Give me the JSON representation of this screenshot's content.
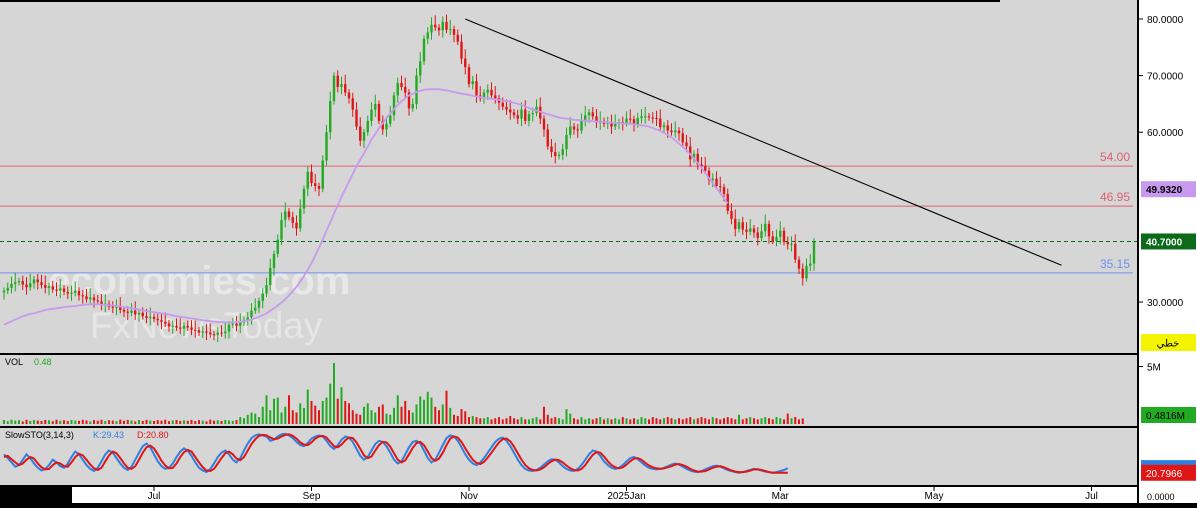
{
  "colors": {
    "pane_bg": "#d6d6d6",
    "axis_bg": "#ffffff",
    "up_candle": "#22aa22",
    "down_candle": "#e01515",
    "ma_line": "#c79af0",
    "trendline": "#000000",
    "resistance": "#e06070",
    "support": "#6f8ff0",
    "last_price": "#0c6b1a",
    "stoch_k": "#2f7fe0",
    "stoch_d": "#e01515",
    "badge_yellow": "#f4f400"
  },
  "watermark": {
    "line1": "economies.com",
    "line2": "FxNewsToday"
  },
  "badge": {
    "label": "خطي"
  },
  "chart_data": [
    {
      "type": "candlestick",
      "pane": "price",
      "ylim": [
        21,
        83
      ],
      "y_ticks": [
        "80.0000",
        "70.0000",
        "60.0000",
        "30.0000"
      ],
      "x_ticks": [
        "Jul",
        "Sep",
        "Nov",
        "2025Jan",
        "Mar",
        "May",
        "Jul"
      ],
      "x_anchors": [
        {
          "label": "Jul",
          "index": 40
        },
        {
          "label": "Sep",
          "index": 82
        },
        {
          "label": "Nov",
          "index": 124
        },
        {
          "label": "2025Jan",
          "index": 166
        },
        {
          "label": "Mar",
          "index": 207
        },
        {
          "label": "May",
          "index": 248
        },
        {
          "label": "Jul",
          "index": 290
        }
      ],
      "close": [
        32,
        32.5,
        33.2,
        33.5,
        33.7,
        33.1,
        32.6,
        33.3,
        34,
        33.5,
        33,
        32.5,
        32.8,
        32.2,
        32,
        32.4,
        31.8,
        31.5,
        31.6,
        32,
        31.2,
        31,
        30.5,
        30.8,
        30.3,
        30.1,
        29.5,
        29.7,
        29.2,
        29,
        29.2,
        28.6,
        28.3,
        28.1,
        28.5,
        27.8,
        28.1,
        27.5,
        27.2,
        27.4,
        27,
        26.8,
        26.5,
        26.2,
        25.7,
        25.8,
        25.5,
        25.3,
        25.8,
        25.5,
        25.1,
        25,
        24.6,
        24.8,
        24.6,
        24.3,
        24.2,
        24.6,
        24.5,
        24.8,
        26,
        26.2,
        25.8,
        26.4,
        26.8,
        27.3,
        28.5,
        29,
        30.2,
        31.5,
        33,
        36,
        38.5,
        41,
        44.5,
        46,
        45,
        44,
        43,
        46.5,
        50,
        53,
        51,
        50.5,
        50,
        55,
        60,
        65.5,
        70,
        68,
        68.5,
        67,
        66,
        64,
        61,
        58.5,
        60,
        62,
        64,
        65,
        62,
        60.5,
        61.5,
        63,
        66.5,
        68.7,
        68,
        67,
        64.2,
        65,
        70,
        72.5,
        76.5,
        77.6,
        79,
        78.5,
        78,
        79.5,
        78.1,
        78.2,
        77.2,
        76,
        73,
        71.5,
        68.5,
        69,
        66.5,
        66,
        67,
        67.5,
        66.5,
        66,
        65.2,
        64.5,
        64,
        63.5,
        63,
        62.4,
        64,
        62,
        63.2,
        63.4,
        64.5,
        62.4,
        60.5,
        57.5,
        56.5,
        55.8,
        56,
        57,
        59.5,
        61,
        60.5,
        60.3,
        62,
        63,
        63.5,
        62.8,
        61.7,
        62,
        61.5,
        61.8,
        61,
        61.5,
        61.8,
        61.6,
        62.4,
        62.3,
        61.4,
        62.5,
        62.8,
        62.8,
        62.6,
        62.5,
        62.4,
        60.9,
        61.2,
        60.3,
        60,
        60.3,
        59.8,
        58.2,
        57.5,
        55.2,
        56.2,
        54.3,
        54,
        53.2,
        51.6,
        51.8,
        50.5,
        50.3,
        49.1,
        46.1,
        44.7,
        42.9,
        44.1,
        42.8,
        42.4,
        43,
        42.3,
        41.3,
        42.5,
        43.8,
        41.6,
        40.8,
        41.5,
        42.6,
        40.6,
        40.2,
        40.3,
        37.5,
        35.9,
        34.2,
        36.4,
        36.8,
        40.7
      ],
      "ma_line": {
        "values": [
          26,
          26.3,
          26.6,
          26.9,
          27.2,
          27.5,
          27.7,
          27.9,
          28,
          28.2,
          28.4,
          28.6,
          28.7,
          28.8,
          28.9,
          29,
          29.1,
          29.2,
          29.25,
          29.3,
          29.4,
          29.5,
          29.55,
          29.6,
          29.6,
          29.6,
          29.55,
          29.5,
          29.45,
          29.4,
          29.3,
          29.2,
          29.1,
          29,
          28.9,
          28.8,
          28.7,
          28.5,
          28.4,
          28.3,
          28.2,
          28.1,
          28,
          27.9,
          27.8,
          27.65,
          27.5,
          27.4,
          27.3,
          27.2,
          27.1,
          27,
          26.9,
          26.8,
          26.7,
          26.6,
          26.55,
          26.5,
          26.45,
          26.4,
          26.4,
          26.4,
          26.45,
          26.5,
          26.6,
          26.75,
          26.9,
          27.15,
          27.4,
          27.7,
          28,
          28.45,
          28.9,
          29.4,
          29.9,
          30.5,
          31.2,
          31.9,
          32.7,
          33.6,
          34.6,
          35.7,
          36.9,
          38.2,
          39.6,
          41.1,
          42.6,
          44.1,
          45.6,
          47.1,
          48.6,
          49.95,
          51.3,
          52.65,
          54,
          55.15,
          56.3,
          57.5,
          58.7,
          59.7,
          60.7,
          61.6,
          62.5,
          63.3,
          64.1,
          64.8,
          65.5,
          66,
          66.5,
          66.8,
          67.1,
          67.3,
          67.5,
          67.55,
          67.6,
          67.6,
          67.6,
          67.5,
          67.4,
          67.25,
          67.1,
          66.95,
          66.8,
          66.7,
          66.6,
          66.45,
          66.3,
          66.2,
          66.1,
          66,
          65.9,
          65.8,
          65.7,
          65.6,
          65.5,
          65.35,
          65.2,
          65,
          64.8,
          64.55,
          64.3,
          64.05,
          63.8,
          63.6,
          63.4,
          63.2,
          63,
          62.8,
          62.6,
          62.5,
          62.4,
          62.3,
          62.2,
          62.15,
          62.1,
          62.05,
          62,
          61.95,
          61.9,
          61.85,
          61.8,
          61.75,
          61.7,
          61.65,
          61.6,
          61.55,
          61.5,
          61.45,
          61.4,
          61.3,
          61.2,
          61.1,
          61,
          60.75,
          60.5,
          60.2,
          59.9,
          59.5,
          59.1,
          58.55,
          58,
          57.4,
          56.8,
          56.1,
          55.4,
          54.55,
          53.7,
          52.8,
          51.9,
          51,
          50.1,
          49.2,
          48.3,
          47.4
        ]
      },
      "trendline": {
        "from": {
          "x_index": 123,
          "y": 80.0
        },
        "to": {
          "x_index": 282,
          "y": 36.5
        }
      },
      "horizontal_levels": [
        {
          "label": "54.00",
          "value": 54.0,
          "color": "#e06070"
        },
        {
          "label": "46.95",
          "value": 46.95,
          "color": "#e06070"
        },
        {
          "label": "35.15",
          "value": 35.15,
          "color": "#6f8ff0"
        }
      ],
      "last_price_line": {
        "value": 40.7,
        "style": "dashed"
      },
      "right_labels": [
        {
          "label": "49.9320",
          "value": 49.932,
          "kind": "ma"
        },
        {
          "label": "40.7000",
          "value": 40.7,
          "kind": "last"
        }
      ]
    },
    {
      "type": "bar",
      "pane": "volume",
      "title": "VOL",
      "current_label": "0.48",
      "ylim": [
        0,
        6
      ],
      "y_ticks": [
        "5M"
      ],
      "right_label": "0.4816M",
      "values": [
        0.35,
        0.25,
        0.38,
        0.3,
        0.33,
        0.22,
        0.37,
        0.27,
        0.34,
        0.3,
        0.26,
        0.36,
        0.32,
        0.24,
        0.38,
        0.28,
        0.33,
        0.25,
        0.35,
        0.3,
        0.27,
        0.37,
        0.31,
        0.23,
        0.34,
        0.29,
        0.36,
        0.26,
        0.33,
        0.3,
        0.25,
        0.38,
        0.28,
        0.35,
        0.31,
        0.22,
        0.34,
        0.27,
        0.36,
        0.3,
        0.26,
        0.33,
        0.29,
        0.37,
        0.24,
        0.31,
        0.35,
        0.27,
        0.32,
        0.28,
        0.36,
        0.25,
        0.34,
        0.3,
        0.23,
        0.38,
        0.29,
        0.32,
        0.26,
        0.35,
        0.31,
        0.28,
        0.34,
        0.6,
        0.5,
        0.8,
        1.0,
        0.9,
        0.6,
        1.5,
        2.5,
        1.2,
        2.2,
        2.3,
        1.0,
        1.5,
        2.5,
        1.2,
        1.0,
        1.8,
        1.4,
        3.0,
        2.0,
        1.6,
        1.2,
        2.0,
        2.3,
        3.5,
        5.3,
        2.2,
        3.2,
        2.0,
        1.8,
        1.2,
        0.9,
        0.8,
        1.5,
        1.8,
        1.2,
        1.0,
        1.5,
        1.7,
        0.9,
        0.8,
        1.4,
        2.5,
        1.5,
        2.0,
        1.2,
        1.0,
        1.7,
        2.4,
        2.1,
        2.8,
        2.3,
        1.5,
        1.2,
        1.7,
        2.9,
        1.4,
        0.8,
        0.7,
        1.3,
        1.1,
        0.6,
        0.7,
        0.6,
        0.5,
        0.5,
        0.6,
        0.4,
        0.5,
        0.6,
        0.4,
        0.5,
        0.7,
        0.5,
        0.4,
        0.6,
        0.4,
        0.4,
        0.5,
        0.6,
        0.4,
        1.5,
        0.8,
        0.5,
        0.6,
        0.5,
        0.4,
        1.3,
        0.9,
        0.5,
        0.4,
        0.6,
        0.4,
        0.5,
        0.4,
        0.5,
        0.6,
        0.4,
        0.5,
        0.4,
        0.5,
        0.4,
        0.6,
        0.5,
        0.4,
        0.5,
        0.4,
        0.6,
        0.5,
        0.4,
        0.6,
        0.5,
        0.4,
        0.5,
        0.6,
        0.5,
        0.4,
        0.5,
        0.4,
        0.5,
        0.6,
        0.4,
        0.5,
        0.6,
        0.5,
        0.4,
        0.6,
        0.5,
        0.4,
        0.5,
        0.6,
        0.5,
        0.4,
        0.8,
        0.4,
        0.5,
        0.6,
        0.5,
        0.4,
        0.5,
        0.6,
        0.5,
        0.4,
        0.6,
        0.5,
        0.4,
        0.9,
        0.5,
        0.6,
        0.4,
        0.48
      ],
      "up_flags": "derived from price close"
    },
    {
      "type": "line",
      "pane": "stochastic",
      "title": "SlowSTO(3,14,3)",
      "k_label": "K:29.43",
      "d_label": "D:20.80",
      "ylim": [
        0,
        100
      ],
      "y_ticks": [
        "0.0000"
      ],
      "right_labels": [
        {
          "label": "29.4340",
          "value": 29.434,
          "kind": "k"
        },
        {
          "label": "20.7966",
          "value": 20.7966,
          "kind": "d"
        }
      ],
      "series": [
        {
          "name": "K",
          "values": [
            55,
            48,
            40,
            32,
            35,
            45,
            55,
            48,
            38,
            30,
            25,
            28,
            35,
            45,
            40,
            33,
            30,
            38,
            50,
            60,
            55,
            45,
            35,
            28,
            24,
            30,
            42,
            55,
            62,
            58,
            48,
            38,
            30,
            26,
            32,
            45,
            58,
            70,
            75,
            68,
            55,
            42,
            33,
            28,
            30,
            38,
            50,
            60,
            66,
            62,
            52,
            40,
            30,
            25,
            22,
            28,
            38,
            50,
            58,
            62,
            55,
            45,
            40,
            48,
            62,
            75,
            85,
            90,
            92,
            90,
            88,
            80,
            82,
            88,
            92,
            93,
            90,
            85,
            78,
            72,
            70,
            76,
            84,
            88,
            90,
            88,
            80,
            70,
            65,
            72,
            82,
            88,
            86,
            78,
            65,
            52,
            45,
            50,
            62,
            74,
            80,
            78,
            70,
            58,
            45,
            38,
            42,
            55,
            68,
            78,
            80,
            75,
            62,
            48,
            40,
            45,
            58,
            72,
            85,
            90,
            88,
            80,
            68,
            55,
            45,
            38,
            35,
            40,
            48,
            58,
            68,
            78,
            84,
            86,
            80,
            70,
            58,
            45,
            35,
            28,
            25,
            24,
            26,
            30,
            36,
            42,
            46,
            45,
            40,
            33,
            28,
            25,
            24,
            28,
            35,
            45,
            55,
            62,
            60,
            52,
            42,
            35,
            30,
            28,
            30,
            35,
            42,
            48,
            50,
            46,
            40,
            34,
            30,
            28,
            27,
            28,
            30,
            33,
            36,
            38,
            36,
            32,
            28,
            25,
            23,
            22,
            24,
            27,
            30,
            33,
            34,
            32,
            29,
            26,
            24,
            22,
            21,
            22,
            24,
            26,
            28,
            27,
            25,
            23,
            22,
            21,
            22,
            24,
            26,
            29.43
          ]
        },
        {
          "name": "D",
          "values": [
            50,
            52,
            46,
            40,
            35,
            38,
            45,
            50,
            47,
            38,
            31,
            27,
            28,
            35,
            40,
            38,
            33,
            32,
            40,
            50,
            56,
            53,
            45,
            36,
            29,
            26,
            30,
            42,
            53,
            60,
            57,
            48,
            38,
            30,
            28,
            33,
            45,
            58,
            68,
            71,
            66,
            55,
            43,
            34,
            29,
            30,
            38,
            50,
            59,
            63,
            60,
            50,
            40,
            31,
            25,
            24,
            28,
            38,
            48,
            57,
            60,
            55,
            47,
            44,
            50,
            62,
            74,
            83,
            89,
            91,
            90,
            86,
            83,
            84,
            88,
            91,
            92,
            89,
            84,
            77,
            73,
            72,
            77,
            84,
            88,
            89,
            86,
            78,
            70,
            68,
            73,
            81,
            86,
            85,
            77,
            65,
            53,
            48,
            51,
            62,
            72,
            78,
            77,
            69,
            57,
            45,
            40,
            44,
            55,
            67,
            76,
            78,
            72,
            60,
            48,
            43,
            47,
            58,
            72,
            84,
            88,
            86,
            78,
            66,
            55,
            45,
            39,
            37,
            41,
            49,
            58,
            68,
            77,
            83,
            84,
            79,
            69,
            57,
            45,
            35,
            29,
            26,
            25,
            27,
            31,
            37,
            42,
            45,
            44,
            40,
            34,
            29,
            26,
            25,
            28,
            35,
            45,
            54,
            59,
            58,
            51,
            42,
            35,
            31,
            29,
            31,
            36,
            42,
            47,
            48,
            45,
            39,
            34,
            31,
            29,
            28,
            29,
            31,
            33,
            36,
            37,
            35,
            32,
            28,
            25,
            23,
            23,
            24,
            27,
            30,
            32,
            33,
            31,
            28,
            25,
            23,
            22,
            22,
            23,
            25,
            27,
            27,
            26,
            24,
            22,
            21,
            21,
            21,
            21,
            20.8
          ]
        }
      ]
    }
  ]
}
